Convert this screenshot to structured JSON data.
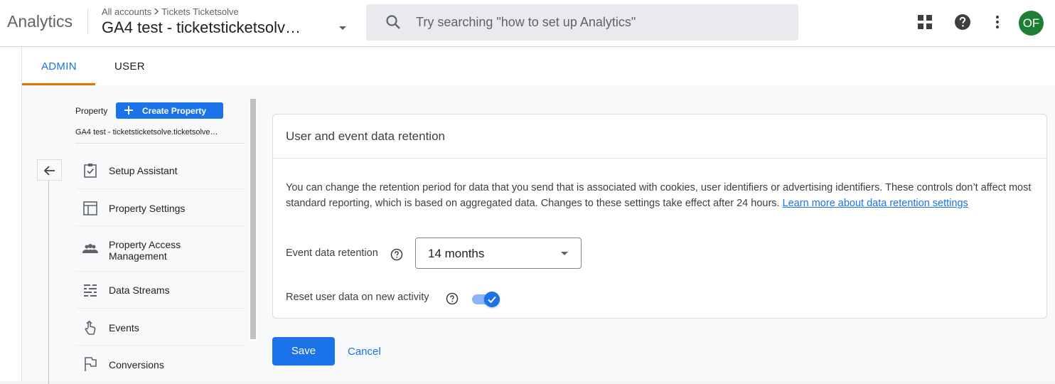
{
  "app": {
    "name": "Analytics",
    "breadcrumb": [
      "All accounts",
      "Tickets Ticketsolve"
    ],
    "property_title": "GA4 test - ticketsticketsolv…"
  },
  "search": {
    "placeholder": "Try searching \"how to set up Analytics\""
  },
  "toolbar": {
    "avatar_initials": "OF"
  },
  "tabs": [
    {
      "label": "ADMIN",
      "active": true
    },
    {
      "label": "USER",
      "active": false
    }
  ],
  "property_panel": {
    "label": "Property",
    "create_button": "Create Property",
    "property_name": "GA4 test - ticketsticketsolve.ticketsolve…"
  },
  "nav_items": [
    {
      "label": "Setup Assistant",
      "icon": "clipboard-check-icon"
    },
    {
      "label": "Property Settings",
      "icon": "property-layout-icon"
    },
    {
      "label": "Property Access Management",
      "icon": "people-icon"
    },
    {
      "label": "Data Streams",
      "icon": "streams-icon"
    },
    {
      "label": "Events",
      "icon": "touch-icon"
    },
    {
      "label": "Conversions",
      "icon": "flag-icon"
    }
  ],
  "card": {
    "title": "User and event data retention",
    "description": "You can change the retention period for data that you send that is associated with cookies, user identifiers or advertising identifiers. These controls don’t affect most standard reporting, which is based on aggregated data. Changes to these settings take effect after 24 hours. ",
    "learn_more": "Learn more about data retention settings",
    "event_retention_label": "Event data retention",
    "event_retention_value": "14 months",
    "reset_label": "Reset user data on new activity",
    "reset_enabled": true
  },
  "actions": {
    "save": "Save",
    "cancel": "Cancel"
  },
  "colors": {
    "primary": "#1a73e8",
    "tab_underline": "#e37400",
    "avatar": "#1e7e34"
  }
}
